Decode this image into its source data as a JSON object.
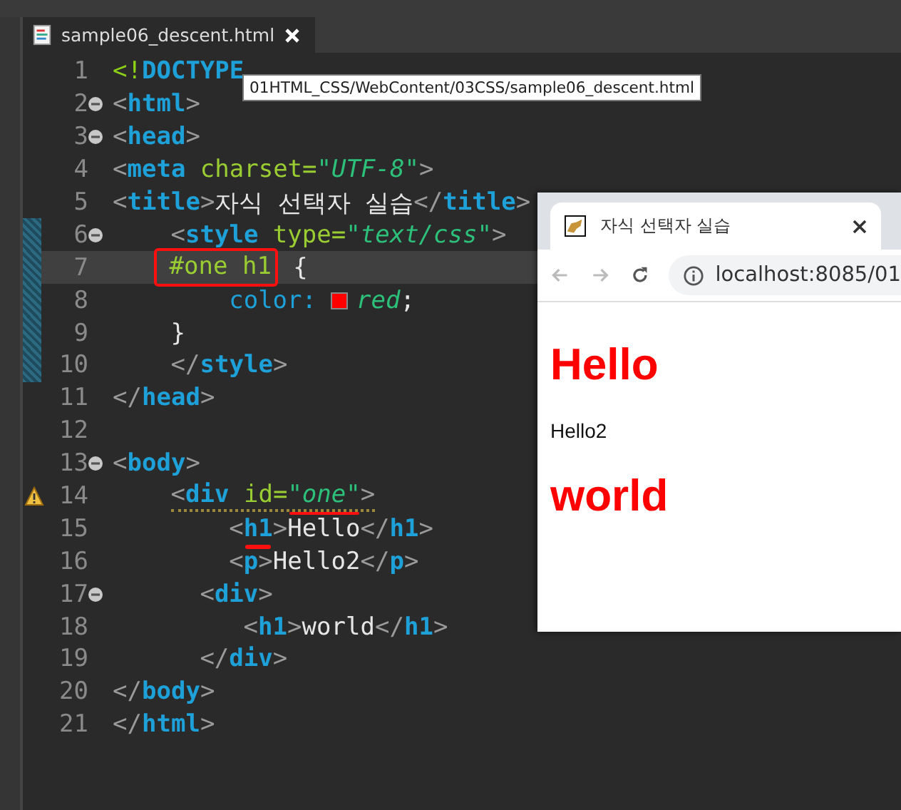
{
  "editor_tab": {
    "title": "sample06_descent.html",
    "selected": true
  },
  "tooltip": "01HTML_CSS/WebContent/03CSS/sample06_descent.html",
  "lines": [
    {
      "number": "1",
      "fold": false,
      "changed": false,
      "current": false,
      "warning": false,
      "tokens": [
        {
          "kind": "doctype",
          "text": "<!"
        },
        {
          "kind": "tag",
          "text": "DOCTYPE"
        }
      ]
    },
    {
      "number": "2",
      "fold": true,
      "changed": false,
      "current": false,
      "warning": false,
      "tokens": [
        {
          "kind": "punct",
          "text": "<"
        },
        {
          "kind": "tag",
          "text": "html"
        },
        {
          "kind": "punct",
          "text": ">"
        }
      ]
    },
    {
      "number": "3",
      "fold": true,
      "changed": false,
      "current": false,
      "warning": false,
      "tokens": [
        {
          "kind": "punct",
          "text": "<"
        },
        {
          "kind": "tag",
          "text": "head"
        },
        {
          "kind": "punct",
          "text": ">"
        }
      ]
    },
    {
      "number": "4",
      "fold": false,
      "changed": false,
      "current": false,
      "warning": false,
      "tokens": [
        {
          "kind": "punct",
          "text": "<"
        },
        {
          "kind": "tag",
          "text": "meta"
        },
        {
          "kind": "attr",
          "text": "charset"
        },
        {
          "kind": "eq",
          "text": "="
        },
        {
          "kind": "value",
          "text": "\"UTF-8\""
        },
        {
          "kind": "punct",
          "text": ">"
        }
      ]
    },
    {
      "number": "5",
      "fold": false,
      "changed": false,
      "current": false,
      "warning": false,
      "tokens": [
        {
          "kind": "punct",
          "text": "<"
        },
        {
          "kind": "tag",
          "text": "title"
        },
        {
          "kind": "punct",
          "text": ">"
        },
        {
          "kind": "text",
          "text": "자식 선택자 실습"
        },
        {
          "kind": "punct",
          "text": "</"
        },
        {
          "kind": "tag",
          "text": "title"
        },
        {
          "kind": "punct",
          "text": ">"
        }
      ]
    },
    {
      "number": "6",
      "fold": true,
      "changed": true,
      "current": false,
      "warning": false,
      "indent": {
        "kind": "i4"
      },
      "tokens": [
        {
          "kind": "punct",
          "text": "<"
        },
        {
          "kind": "tag",
          "text": "style"
        },
        {
          "kind": "attr",
          "text": "type"
        },
        {
          "kind": "eq",
          "text": "="
        },
        {
          "kind": "value",
          "text": "\"text/css\""
        },
        {
          "kind": "punct",
          "text": ">"
        }
      ]
    },
    {
      "number": "7",
      "fold": false,
      "changed": true,
      "current": true,
      "warning": false,
      "indent": {
        "kind": "i4"
      },
      "tokens": [
        {
          "kind": "selector",
          "text": "#one h1",
          "annotated": {
            "kind": "box"
          }
        },
        {
          "kind": "text",
          "text": "{"
        }
      ]
    },
    {
      "number": "8",
      "fold": false,
      "changed": true,
      "current": false,
      "warning": false,
      "indent": {
        "kind": "i8"
      },
      "tokens": [
        {
          "kind": "property",
          "text": "color:"
        },
        {
          "kind": "swatch",
          "color": "#ff0000"
        },
        {
          "kind": "value",
          "text": "red"
        },
        {
          "kind": "text",
          "text": ";"
        }
      ]
    },
    {
      "number": "9",
      "fold": false,
      "changed": true,
      "current": false,
      "warning": false,
      "indent": {
        "kind": "i4"
      },
      "tokens": [
        {
          "kind": "text",
          "text": "}"
        }
      ]
    },
    {
      "number": "10",
      "fold": false,
      "changed": true,
      "current": false,
      "warning": false,
      "indent": {
        "kind": "i4"
      },
      "tokens": [
        {
          "kind": "punct",
          "text": "</"
        },
        {
          "kind": "tag",
          "text": "style"
        },
        {
          "kind": "punct",
          "text": ">"
        }
      ]
    },
    {
      "number": "11",
      "fold": false,
      "changed": false,
      "current": false,
      "warning": false,
      "tokens": [
        {
          "kind": "punct",
          "text": "</"
        },
        {
          "kind": "tag",
          "text": "head"
        },
        {
          "kind": "punct",
          "text": ">"
        }
      ]
    },
    {
      "number": "12",
      "fold": false,
      "changed": false,
      "current": false,
      "warning": false
    },
    {
      "number": "13",
      "fold": true,
      "changed": false,
      "current": false,
      "warning": false,
      "tokens": [
        {
          "kind": "punct",
          "text": "<"
        },
        {
          "kind": "tag",
          "text": "body"
        },
        {
          "kind": "punct",
          "text": ">"
        }
      ]
    },
    {
      "number": "14",
      "fold": false,
      "changed": false,
      "current": false,
      "warning": true,
      "indent": {
        "kind": "i4"
      },
      "tokens": [
        {
          "kind": "punct",
          "text": "<"
        },
        {
          "kind": "tag",
          "text": "div"
        },
        {
          "kind": "attr",
          "text": "id"
        },
        {
          "kind": "eq",
          "text": "="
        },
        {
          "kind": "value",
          "text": "\"one\"",
          "annotated": {
            "kind": "underline"
          }
        },
        {
          "kind": "punct",
          "text": ">"
        }
      ]
    },
    {
      "number": "15",
      "fold": false,
      "changed": false,
      "current": false,
      "warning": false,
      "indent": {
        "kind": "i8"
      },
      "tokens": [
        {
          "kind": "punct",
          "text": "<"
        },
        {
          "kind": "tag",
          "text": "h1",
          "annotated": {
            "kind": "underline"
          }
        },
        {
          "kind": "punct",
          "text": ">"
        },
        {
          "kind": "text",
          "text": "Hello"
        },
        {
          "kind": "punct",
          "text": "</"
        },
        {
          "kind": "tag",
          "text": "h1"
        },
        {
          "kind": "punct",
          "text": ">"
        }
      ]
    },
    {
      "number": "16",
      "fold": false,
      "changed": false,
      "current": false,
      "warning": false,
      "indent": {
        "kind": "i8"
      },
      "tokens": [
        {
          "kind": "punct",
          "text": "<"
        },
        {
          "kind": "tag",
          "text": "p"
        },
        {
          "kind": "punct",
          "text": ">"
        },
        {
          "kind": "text",
          "text": "Hello2"
        },
        {
          "kind": "punct",
          "text": "</"
        },
        {
          "kind": "tag",
          "text": "p"
        },
        {
          "kind": "punct",
          "text": ">"
        }
      ]
    },
    {
      "number": "17",
      "fold": true,
      "changed": false,
      "current": false,
      "warning": false,
      "indent": {
        "kind": "i6"
      },
      "tokens": [
        {
          "kind": "punct",
          "text": "<"
        },
        {
          "kind": "tag",
          "text": "div"
        },
        {
          "kind": "punct",
          "text": ">"
        }
      ]
    },
    {
      "number": "18",
      "fold": false,
      "changed": false,
      "current": false,
      "warning": false,
      "indent": {
        "kind": "i9"
      },
      "tokens": [
        {
          "kind": "punct",
          "text": "<"
        },
        {
          "kind": "tag",
          "text": "h1"
        },
        {
          "kind": "punct",
          "text": ">"
        },
        {
          "kind": "text",
          "text": "world"
        },
        {
          "kind": "punct",
          "text": "</"
        },
        {
          "kind": "tag",
          "text": "h1"
        },
        {
          "kind": "punct",
          "text": ">"
        }
      ]
    },
    {
      "number": "19",
      "fold": false,
      "changed": false,
      "current": false,
      "warning": false,
      "indent": {
        "kind": "i6"
      },
      "tokens": [
        {
          "kind": "punct",
          "text": "</"
        },
        {
          "kind": "tag",
          "text": "div"
        },
        {
          "kind": "punct",
          "text": ">"
        }
      ]
    },
    {
      "number": "20",
      "fold": false,
      "changed": false,
      "current": false,
      "warning": false,
      "tokens": [
        {
          "kind": "punct",
          "text": "</"
        },
        {
          "kind": "tag",
          "text": "body"
        },
        {
          "kind": "punct",
          "text": ">"
        }
      ]
    },
    {
      "number": "21",
      "fold": false,
      "changed": false,
      "current": false,
      "warning": false,
      "tokens": [
        {
          "kind": "punct",
          "text": "</"
        },
        {
          "kind": "tag",
          "text": "html"
        },
        {
          "kind": "punct",
          "text": ">"
        }
      ]
    }
  ],
  "browser": {
    "tab_title": "자식 선택자 실습",
    "url": "localhost:8085/01",
    "content": [
      {
        "kind": "heading",
        "text": "Hello"
      },
      {
        "kind": "paragraph",
        "text": "Hello2"
      },
      {
        "kind": "heading",
        "text": "world"
      }
    ]
  }
}
